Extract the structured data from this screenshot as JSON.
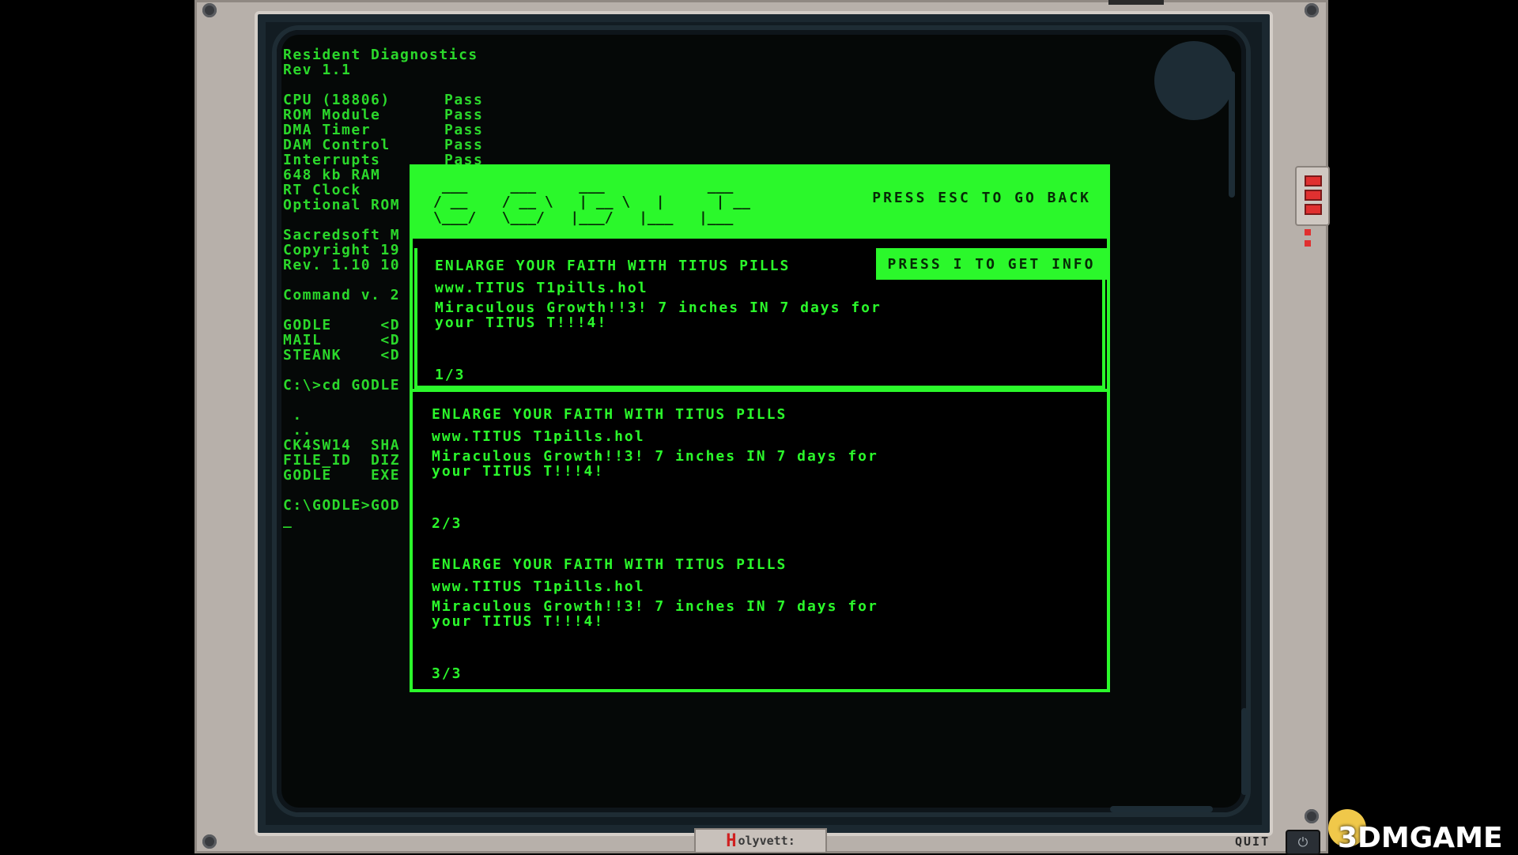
{
  "console": {
    "lines": [
      "Resident Diagnostics",
      "Rev 1.1",
      "",
      "CPU (18806)|Pass",
      "ROM Module|Pass",
      "DMA Timer|Pass",
      "DAM Control|Pass",
      "Interrupts|Pass",
      "648 kb RAM",
      "RT Clock",
      "Optional ROM",
      "",
      "Sacredsoft M",
      "Copyright 19",
      "Rev. 1.10 10",
      "",
      "Command v. 2",
      "",
      "GODLE     <D",
      "MAIL      <D",
      "STEANK    <D",
      "",
      "C:\\>cd GODLE",
      "",
      " .",
      " ..",
      "CK4SW14  SHA",
      "FILE_ID  DIZ",
      "GODLE    EXE",
      "",
      "C:\\GODLE>GOD",
      "_"
    ]
  },
  "godle": {
    "logo": " ___     ___     ___            ___\n/ __    / __ \\   | __ \\   |      | __\n\\___/   \\___/   |___/   |___   |___",
    "esc_label": "PRESS ESC TO GO BACK",
    "info_label": "PRESS I TO GET INFO",
    "results": [
      {
        "title": "ENLARGE YOUR FAITH WITH TITUS  PILLS",
        "url": "www.TITUS T1pills.hol",
        "desc": "Miraculous Growth!!3! 7 inches IN 7 days for your TITUS T!!!4!",
        "pager": "1/3"
      },
      {
        "title": "ENLARGE YOUR FAITH WITH TITUS  PILLS",
        "url": "www.TITUS T1pills.hol",
        "desc": "Miraculous Growth!!3! 7 inches IN 7 days for your TITUS T!!!4!",
        "pager": "2/3"
      },
      {
        "title": "ENLARGE YOUR FAITH WITH TITUS  PILLS",
        "url": "www.TITUS T1pills.hol",
        "desc": "Miraculous Growth!!3! 7 inches IN 7 days for your TITUS T!!!4!",
        "pager": "3/3"
      }
    ]
  },
  "case": {
    "brand_letter": "H",
    "brand_rest": "olyvett:",
    "quit_label": "QUIT",
    "power_icon": "power-icon"
  },
  "watermark": "3DMGAME",
  "colors": {
    "terminal_green": "#2bf82b",
    "console_green": "#2bd82b",
    "case": "#b7b0aa",
    "led_red": "#e03030"
  }
}
